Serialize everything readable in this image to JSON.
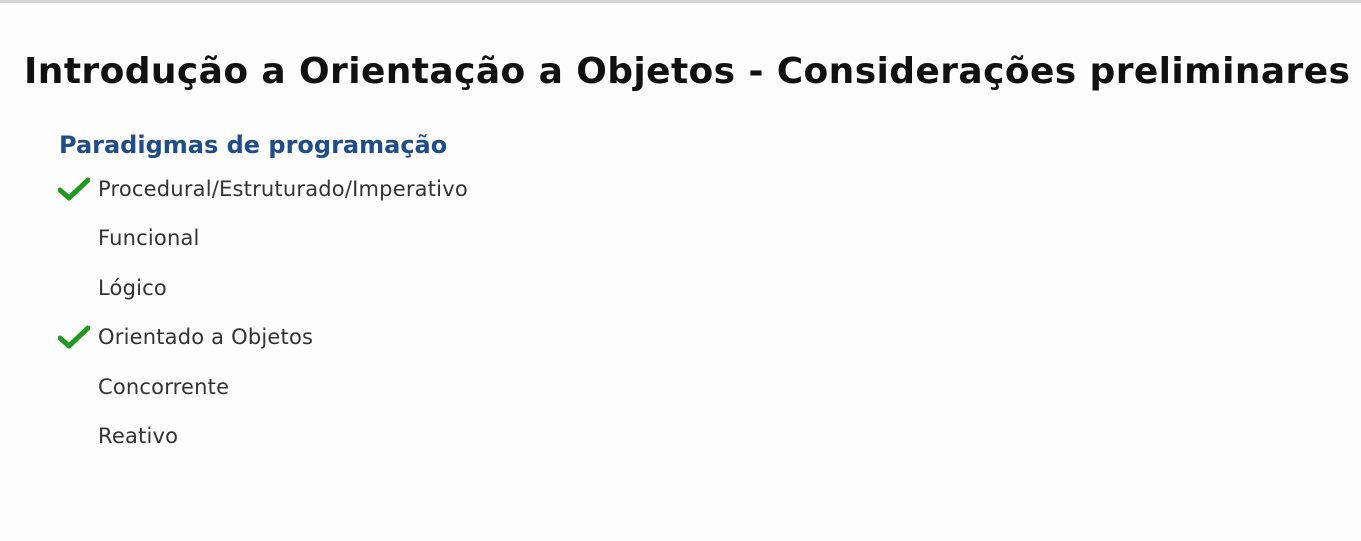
{
  "slide": {
    "title": "Introdução a Orientação a Objetos - Considerações preliminares",
    "subtitle": "Paradigmas de programação",
    "items": [
      {
        "label": "Procedural/Estruturado/Imperativo",
        "checked": true
      },
      {
        "label": "Funcional",
        "checked": false
      },
      {
        "label": "Lógico",
        "checked": false
      },
      {
        "label": "Orientado a Objetos",
        "checked": true
      },
      {
        "label": "Concorrente",
        "checked": false
      },
      {
        "label": "Reativo",
        "checked": false
      }
    ]
  },
  "colors": {
    "title": "#111111",
    "subtitle": "#1f4c8a",
    "item_text": "#333333",
    "check": "#1f9a1f"
  },
  "icons": {
    "check": "checkmark-icon"
  }
}
